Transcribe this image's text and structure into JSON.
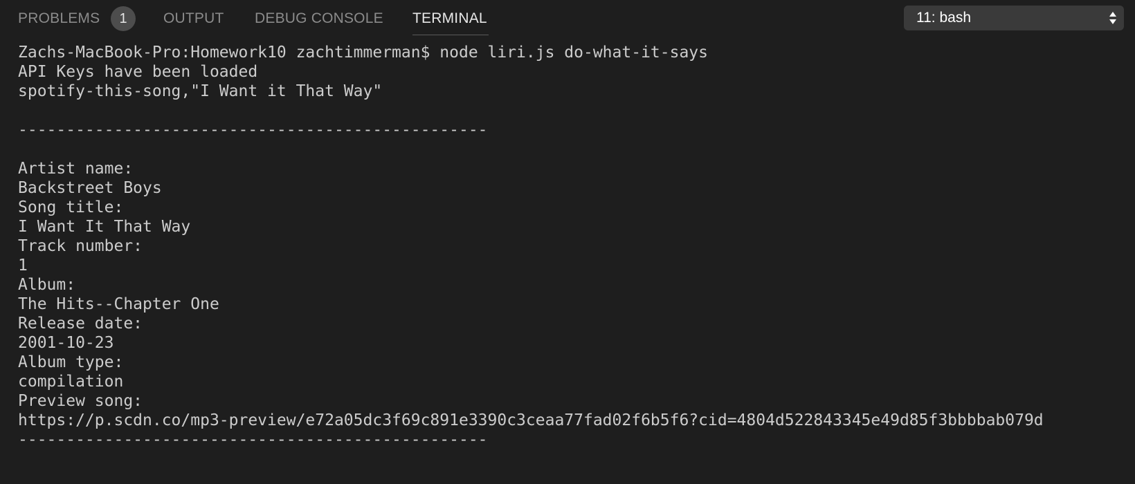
{
  "panel": {
    "tabs": [
      {
        "label": "PROBLEMS",
        "badge": "1"
      },
      {
        "label": "OUTPUT"
      },
      {
        "label": "DEBUG CONSOLE"
      },
      {
        "label": "TERMINAL"
      }
    ],
    "active_tab": "TERMINAL",
    "terminal_selector": {
      "value": "11: bash",
      "icon": "up-down-chevron-icon"
    }
  },
  "terminal": {
    "lines": [
      "Zachs-MacBook-Pro:Homework10 zachtimmerman$ node liri.js do-what-it-says",
      "API Keys have been loaded",
      "spotify-this-song,\"I Want it That Way\"",
      "",
      "-------------------------------------------------",
      "",
      "Artist name:",
      "Backstreet Boys",
      "Song title:",
      "I Want It That Way",
      "Track number:",
      "1",
      "Album:",
      "The Hits--Chapter One",
      "Release date:",
      "2001-10-23",
      "Album type:",
      "compilation",
      "Preview song:",
      "https://p.scdn.co/mp3-preview/e72a05dc3f69c891e3390c3ceaa77fad02f6b5f6?cid=4804d522843345e49d85f3bbbbab079d",
      "-------------------------------------------------"
    ]
  },
  "colors": {
    "background": "#1e1e1e",
    "tab_inactive": "#8b8b8b",
    "tab_active": "#e7e7e7",
    "terminal_text": "#cccccc"
  }
}
